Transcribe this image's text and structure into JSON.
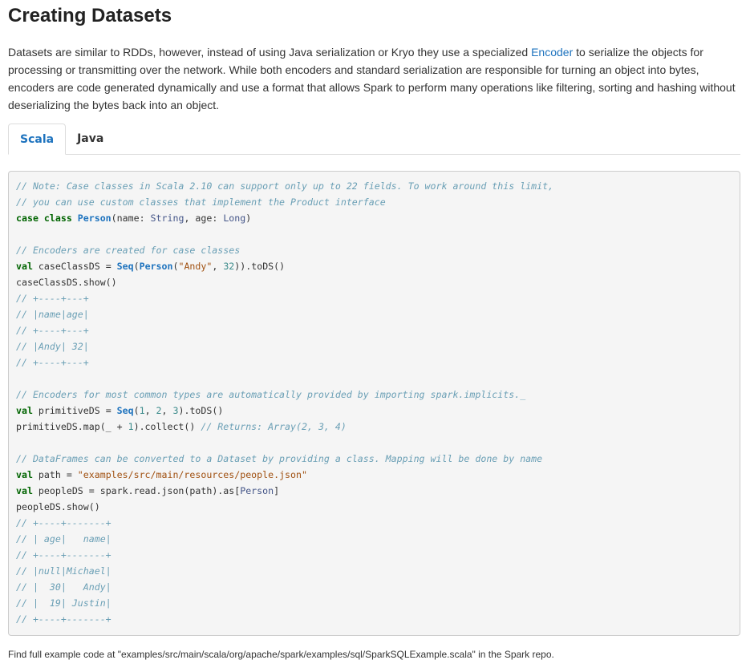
{
  "heading": "Creating Datasets",
  "intro": {
    "before_link": "Datasets are similar to RDDs, however, instead of using Java serialization or Kryo they use a specialized ",
    "link": "Encoder",
    "after_link": " to serialize the objects for processing or transmitting over the network. While both encoders and standard serialization are responsible for turning an object into bytes, encoders are code generated dynamically and use a format that allows Spark to perform many operations like filtering, sorting and hashing without deserializing the bytes back into an object."
  },
  "tabs": [
    {
      "label": "Scala",
      "active": true
    },
    {
      "label": "Java",
      "active": false
    }
  ],
  "code_lines": [
    [
      {
        "c": "c",
        "t": "// Note: Case classes in Scala 2.10 can support only up to 22 fields. To work around this limit,"
      }
    ],
    [
      {
        "c": "c",
        "t": "// you can use custom classes that implement the Product interface"
      }
    ],
    [
      {
        "c": "k",
        "t": "case class "
      },
      {
        "c": "n",
        "t": "Person"
      },
      {
        "c": "",
        "t": "(name: "
      },
      {
        "c": "t",
        "t": "String"
      },
      {
        "c": "",
        "t": ", age: "
      },
      {
        "c": "t",
        "t": "Long"
      },
      {
        "c": "",
        "t": ")"
      }
    ],
    [],
    [
      {
        "c": "c",
        "t": "// Encoders are created for case classes"
      }
    ],
    [
      {
        "c": "k",
        "t": "val"
      },
      {
        "c": "",
        "t": " caseClassDS = "
      },
      {
        "c": "n",
        "t": "Seq"
      },
      {
        "c": "",
        "t": "("
      },
      {
        "c": "n",
        "t": "Person"
      },
      {
        "c": "",
        "t": "("
      },
      {
        "c": "s",
        "t": "\"Andy\""
      },
      {
        "c": "",
        "t": ", "
      },
      {
        "c": "m",
        "t": "32"
      },
      {
        "c": "",
        "t": ")).toDS()"
      }
    ],
    [
      {
        "c": "",
        "t": "caseClassDS.show()"
      }
    ],
    [
      {
        "c": "c",
        "t": "// +----+---+"
      }
    ],
    [
      {
        "c": "c",
        "t": "// |name|age|"
      }
    ],
    [
      {
        "c": "c",
        "t": "// +----+---+"
      }
    ],
    [
      {
        "c": "c",
        "t": "// |Andy| 32|"
      }
    ],
    [
      {
        "c": "c",
        "t": "// +----+---+"
      }
    ],
    [],
    [
      {
        "c": "c",
        "t": "// Encoders for most common types are automatically provided by importing spark.implicits._"
      }
    ],
    [
      {
        "c": "k",
        "t": "val"
      },
      {
        "c": "",
        "t": " primitiveDS = "
      },
      {
        "c": "n",
        "t": "Seq"
      },
      {
        "c": "",
        "t": "("
      },
      {
        "c": "m",
        "t": "1"
      },
      {
        "c": "",
        "t": ", "
      },
      {
        "c": "m",
        "t": "2"
      },
      {
        "c": "",
        "t": ", "
      },
      {
        "c": "m",
        "t": "3"
      },
      {
        "c": "",
        "t": ").toDS()"
      }
    ],
    [
      {
        "c": "",
        "t": "primitiveDS.map(_ + "
      },
      {
        "c": "m",
        "t": "1"
      },
      {
        "c": "",
        "t": ").collect() "
      },
      {
        "c": "c",
        "t": "// Returns: Array(2, 3, 4)"
      }
    ],
    [],
    [
      {
        "c": "c",
        "t": "// DataFrames can be converted to a Dataset by providing a class. Mapping will be done by name"
      }
    ],
    [
      {
        "c": "k",
        "t": "val"
      },
      {
        "c": "",
        "t": " path = "
      },
      {
        "c": "s",
        "t": "\"examples/src/main/resources/people.json\""
      }
    ],
    [
      {
        "c": "k",
        "t": "val"
      },
      {
        "c": "",
        "t": " peopleDS = spark.read.json(path).as["
      },
      {
        "c": "t",
        "t": "Person"
      },
      {
        "c": "",
        "t": "]"
      }
    ],
    [
      {
        "c": "",
        "t": "peopleDS.show()"
      }
    ],
    [
      {
        "c": "c",
        "t": "// +----+-------+"
      }
    ],
    [
      {
        "c": "c",
        "t": "// | age|   name|"
      }
    ],
    [
      {
        "c": "c",
        "t": "// +----+-------+"
      }
    ],
    [
      {
        "c": "c",
        "t": "// |null|Michael|"
      }
    ],
    [
      {
        "c": "c",
        "t": "// |  30|   Andy|"
      }
    ],
    [
      {
        "c": "c",
        "t": "// |  19| Justin|"
      }
    ],
    [
      {
        "c": "c",
        "t": "// +----+-------+"
      }
    ]
  ],
  "footer": "Find full example code at \"examples/src/main/scala/org/apache/spark/examples/sql/SparkSQLExample.scala\" in the Spark repo."
}
